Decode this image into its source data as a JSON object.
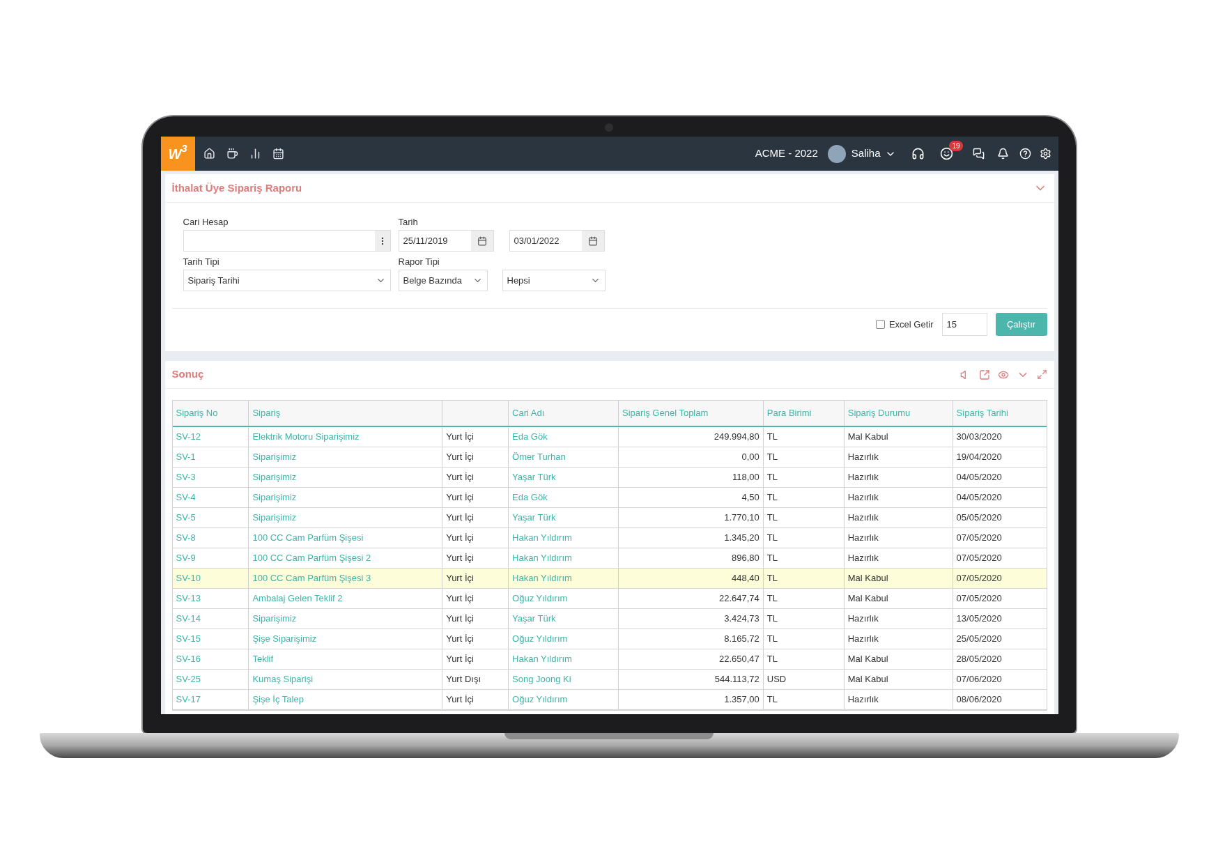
{
  "app": {
    "logo": "W$^{3}$",
    "company": "ACME - 2022",
    "user": "Saliha",
    "notification_count": "19"
  },
  "filter_panel": {
    "title": "İthalat Üye Sipariş Raporu",
    "cari_hesap": {
      "label": "Cari Hesap"
    },
    "tarih": {
      "label": "Tarih",
      "start": "25/11/2019",
      "end": "03/01/2022"
    },
    "tarih_tipi": {
      "label": "Tarih Tipi",
      "value": "Sipariş Tarihi"
    },
    "rapor_tipi": {
      "label": "Rapor Tipi",
      "value": "Belge Bazında"
    },
    "filter_3": {
      "value": "Hepsi"
    },
    "excel": {
      "label": "Excel Getir",
      "checked": false
    },
    "page_size": "15",
    "run_button": "Çalıştır"
  },
  "result_panel": {
    "title": "Sonuç",
    "columns": [
      {
        "label": "Sipariş No"
      },
      {
        "label": "Sipariş"
      },
      {},
      {
        "label": "Cari Adı"
      },
      {
        "label": "Sipariş Genel Toplam"
      },
      {
        "label": "Para Birimi"
      },
      {
        "label": "Sipariş Durumu"
      },
      {
        "label": "Sipariş Tarihi"
      }
    ],
    "rows": [
      {
        "selected": false,
        "cells": [
          "SV-12",
          "Elektrik Motoru Siparişimiz",
          "Yurt İçi",
          "Eda Gök",
          "249.994,80",
          "TL",
          "Mal Kabul",
          "30/03/2020"
        ]
      },
      {
        "selected": false,
        "cells": [
          "SV-1",
          "Siparişimiz",
          "Yurt İçi",
          "Ömer Turhan",
          "0,00",
          "TL",
          "Hazırlık",
          "19/04/2020"
        ]
      },
      {
        "selected": false,
        "cells": [
          "SV-3",
          "Siparişimiz",
          "Yurt İçi",
          "Yaşar Türk",
          "118,00",
          "TL",
          "Hazırlık",
          "04/05/2020"
        ]
      },
      {
        "selected": false,
        "cells": [
          "SV-4",
          "Siparişimiz",
          "Yurt İçi",
          "Eda Gök",
          "4,50",
          "TL",
          "Hazırlık",
          "04/05/2020"
        ]
      },
      {
        "selected": false,
        "cells": [
          "SV-5",
          "Siparişimiz",
          "Yurt İçi",
          "Yaşar Türk",
          "1.770,10",
          "TL",
          "Hazırlık",
          "05/05/2020"
        ]
      },
      {
        "selected": false,
        "cells": [
          "SV-8",
          "100 CC Cam Parfüm Şişesi",
          "Yurt İçi",
          "Hakan Yıldırım",
          "1.345,20",
          "TL",
          "Hazırlık",
          "07/05/2020"
        ]
      },
      {
        "selected": false,
        "cells": [
          "SV-9",
          "100 CC Cam Parfüm Şişesi 2",
          "Yurt İçi",
          "Hakan Yıldırım",
          "896,80",
          "TL",
          "Hazırlık",
          "07/05/2020"
        ]
      },
      {
        "selected": true,
        "cells": [
          "SV-10",
          "100 CC Cam Parfüm Şişesi 3",
          "Yurt İçi",
          "Hakan Yıldırım",
          "448,40",
          "TL",
          "Mal Kabul",
          "07/05/2020"
        ]
      },
      {
        "selected": false,
        "cells": [
          "SV-13",
          "Ambalaj Gelen Teklif 2",
          "Yurt İçi",
          "Oğuz Yıldırım",
          "22.647,74",
          "TL",
          "Mal Kabul",
          "07/05/2020"
        ]
      },
      {
        "selected": false,
        "cells": [
          "SV-14",
          "Siparişimiz",
          "Yurt İçi",
          "Yaşar Türk",
          "3.424,73",
          "TL",
          "Hazırlık",
          "13/05/2020"
        ]
      },
      {
        "selected": false,
        "cells": [
          "SV-15",
          "Şişe Siparişimiz",
          "Yurt İçi",
          "Oğuz Yıldırım",
          "8.165,72",
          "TL",
          "Hazırlık",
          "25/05/2020"
        ]
      },
      {
        "selected": false,
        "cells": [
          "SV-16",
          "Teklif",
          "Yurt İçi",
          "Hakan Yıldırım",
          "22.650,47",
          "TL",
          "Mal Kabul",
          "28/05/2020"
        ]
      },
      {
        "selected": false,
        "cells": [
          "SV-25",
          "Kumaş Siparişi",
          "Yurt Dışı",
          "Song Joong Ki",
          "544.113,72",
          "USD",
          "Mal Kabul",
          "07/06/2020"
        ]
      },
      {
        "selected": false,
        "cells": [
          "SV-17",
          "Şişe İç Talep",
          "Yurt İçi",
          "Oğuz Yıldırım",
          "1.357,00",
          "TL",
          "Hazırlık",
          "08/06/2020"
        ]
      }
    ]
  }
}
